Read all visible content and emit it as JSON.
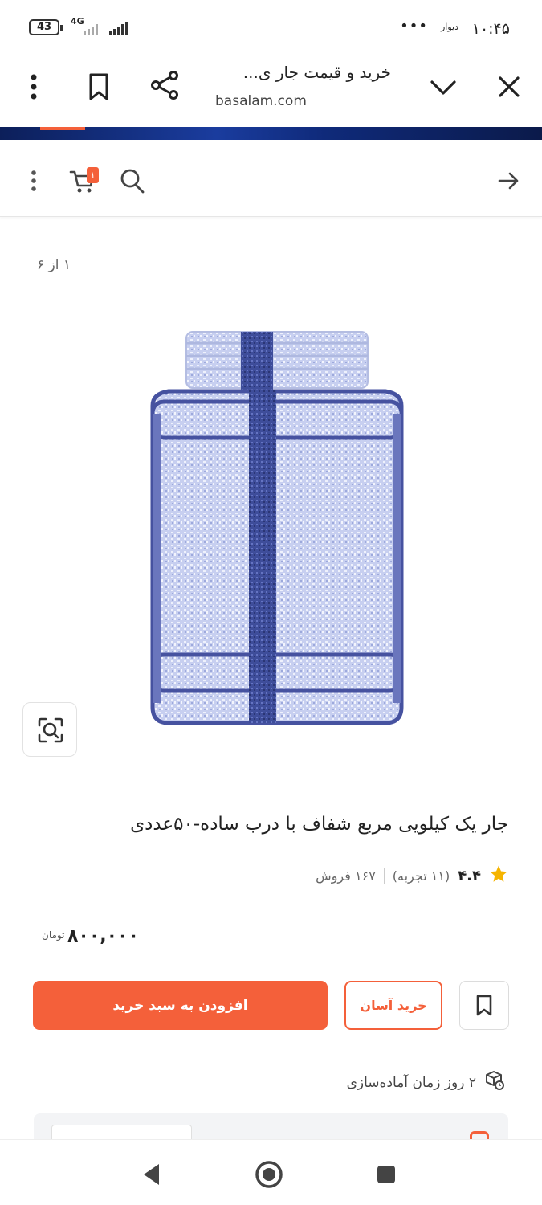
{
  "status_bar": {
    "battery": "43",
    "network": "4G",
    "app_name": "دیوار",
    "more": "•••",
    "time": "۱۰:۴۵"
  },
  "browser": {
    "title": "خرید و قیمت جار ی...",
    "url": "basalam.com"
  },
  "header": {
    "cart_count": "۱"
  },
  "gallery": {
    "counter": "۱ از ۶"
  },
  "product": {
    "title": "جار یک کیلویی مربع شفاف با درب ساده-۵۰عددی",
    "rating": "۴.۴",
    "reviews": "(۱۱ تجربه)",
    "sales": "۱۶۷ فروش",
    "price": "۸۰۰,۰۰۰",
    "currency": "تومان",
    "prep_time": "۲ روز زمان آماده‌سازی"
  },
  "actions": {
    "add_to_cart": "افزودن به سبد خرید",
    "easy_buy": "خرید آسان"
  },
  "colors": {
    "accent": "#f4603a",
    "star": "#f5b400"
  }
}
